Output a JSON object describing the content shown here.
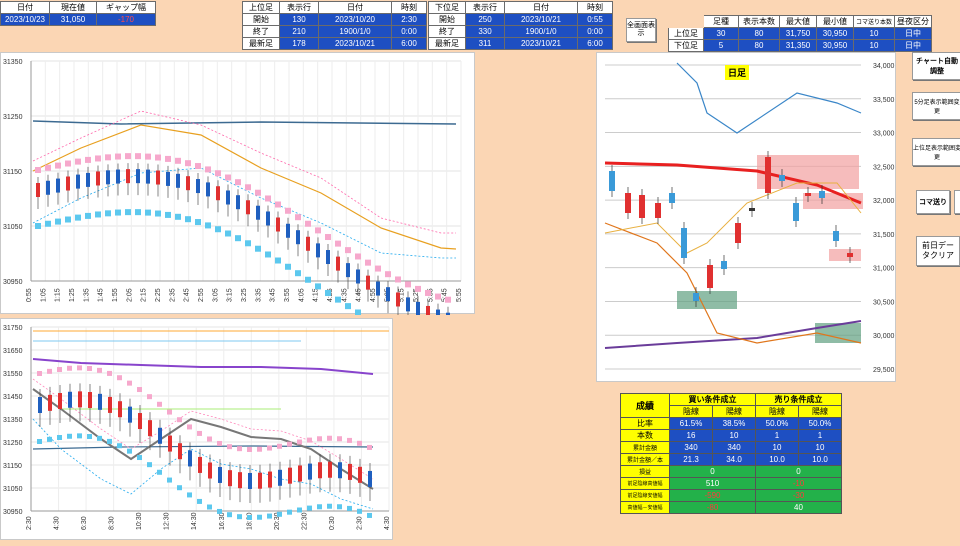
{
  "top_left": {
    "headers": [
      "日付",
      "現在値",
      "ギャップ幅"
    ],
    "values": [
      "2023/10/23",
      "31,050",
      "-170"
    ]
  },
  "upper_tf": {
    "headers": [
      "上位足",
      "表示行",
      "日付",
      "時刻"
    ],
    "rows": [
      [
        "開始",
        "130",
        "2023/10/20",
        "2:30"
      ],
      [
        "終了",
        "210",
        "1900/1/0",
        "0:00"
      ],
      [
        "最新足",
        "178",
        "2023/10/21",
        "6:00"
      ]
    ]
  },
  "lower_tf": {
    "headers": [
      "下位足",
      "表示行",
      "日付",
      "時刻"
    ],
    "rows": [
      [
        "開始",
        "250",
        "2023/10/21",
        "0:55"
      ],
      [
        "終了",
        "330",
        "1900/1/0",
        "0:00"
      ],
      [
        "最新足",
        "311",
        "2023/10/21",
        "6:00"
      ]
    ]
  },
  "full_display_button": "全画面表示",
  "right_summary": {
    "headers": [
      "",
      "足種",
      "表示本数",
      "最大値",
      "最小値",
      "コマ送り本数",
      "昼夜区分"
    ],
    "rows": [
      [
        "上位足",
        "30",
        "80",
        "31,750",
        "30,950",
        "10",
        "日中"
      ],
      [
        "下位足",
        "5",
        "80",
        "31,350",
        "30,950",
        "10",
        "日中"
      ]
    ]
  },
  "side_buttons": [
    "チャート自動調整",
    "5分足表示範囲変更",
    "上位足表示範囲変更",
    "コマ送り",
    "前日データクリア"
  ],
  "daily_chart": {
    "label": "日足",
    "y_ticks": [
      "34,000",
      "33,500",
      "33,000",
      "32,500",
      "32,000",
      "31,500",
      "31,000",
      "30,500",
      "30,000",
      "29,500"
    ]
  },
  "chart1": {
    "y_ticks": [
      "31350",
      "31250",
      "31150",
      "31050",
      "30950"
    ],
    "x_ticks": [
      "0:55",
      "1:05",
      "1:15",
      "1:25",
      "1:35",
      "1:45",
      "1:55",
      "2:05",
      "2:15",
      "2:25",
      "2:35",
      "2:45",
      "2:55",
      "3:05",
      "3:15",
      "3:25",
      "3:35",
      "3:45",
      "3:55",
      "4:05",
      "4:15",
      "4:25",
      "4:35",
      "4:45",
      "4:55",
      "5:05",
      "5:15",
      "5:25",
      "5:35",
      "5:45",
      "5:55"
    ]
  },
  "chart2": {
    "y_ticks": [
      "31750",
      "31650",
      "31550",
      "31450",
      "31350",
      "31250",
      "31150",
      "31050",
      "30950"
    ],
    "x_ticks": [
      "2:30",
      "4:30",
      "6:30",
      "8:30",
      "10:30",
      "12:30",
      "14:30",
      "16:30",
      "18:30",
      "20:30",
      "22:30",
      "0:30",
      "2:30",
      "4:30"
    ]
  },
  "stats": {
    "title": "成績",
    "buy_header": "買い条件成立",
    "sell_header": "売り条件成立",
    "sub": [
      "陰線",
      "陽線",
      "陰線",
      "陽線"
    ],
    "rows": [
      {
        "label": "比率",
        "v": [
          "61.5%",
          "38.5%",
          "50.0%",
          "50.0%"
        ]
      },
      {
        "label": "本数",
        "v": [
          "16",
          "10",
          "1",
          "1"
        ]
      },
      {
        "label": "累計金額",
        "v": [
          "340",
          "340",
          "10",
          "10"
        ]
      },
      {
        "label": "累計金額／本",
        "v": [
          "21.3",
          "34.0",
          "10.0",
          "10.0"
        ]
      }
    ],
    "rows2": [
      {
        "label": "損益",
        "buy": "0",
        "sell": "0"
      },
      {
        "label": "前足陰線高値幅",
        "buy": "510",
        "sell": "-10"
      },
      {
        "label": "前足陰線安値幅",
        "buy": "-590",
        "sell": "-30"
      },
      {
        "label": "高値幅－安値幅",
        "buy": "-80",
        "sell": "40"
      }
    ]
  }
}
